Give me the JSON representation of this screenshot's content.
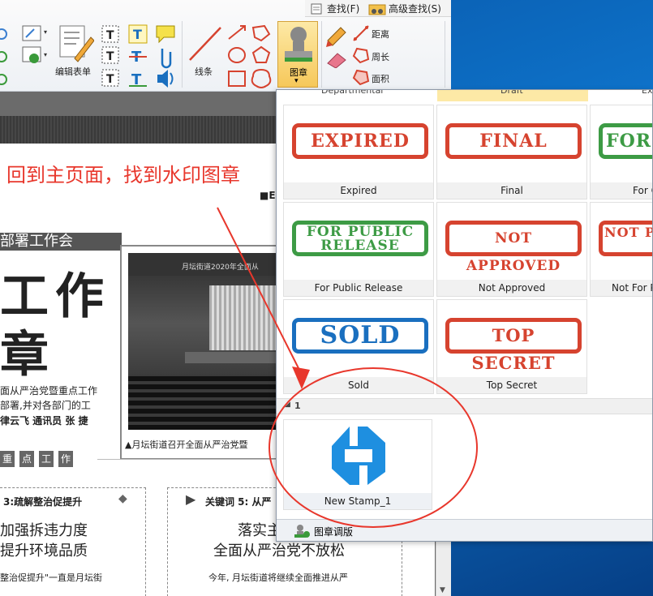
{
  "toolbar": {
    "search_label": "查找(F)",
    "advanced_search_label": "高级查找(S)",
    "edit_form_label": "编辑表单",
    "line_label": "线条",
    "stamp_label": "图章",
    "distance_label": "距离",
    "perimeter_label": "周长",
    "area_label": "面积"
  },
  "annotation": {
    "text": "回到主页面，找到水印图章"
  },
  "document": {
    "header_block": "■E",
    "section_title": "部署工作会",
    "big_char_1": "工作",
    "big_char_2": "章",
    "body_line_1": "面从严治党暨重点工作",
    "body_line_2": "部署,并对各部门的工",
    "byline": "律云飞 通讯员 张 捷",
    "banner_text": "月坛街道2020年全面从",
    "photo_caption": "▲月坛街道召开全面从严治党暨",
    "key_points": [
      "重",
      "点",
      "工",
      "作"
    ],
    "card1_title": "3:疏解整治促提升",
    "card1_line1": "加强拆违力度",
    "card1_line2": "提升环境品质",
    "card1_text": "整治促提升\"一直是月坛街",
    "card2_title": "关键词 5: 从严",
    "card2_line1": "落实主",
    "card2_line2": "全面从严治党不放松",
    "card2_text": "今年, 月坛街道将继续全面推进从严"
  },
  "panel": {
    "top_row_labels": [
      "Departmental",
      "Draft",
      "Expe"
    ],
    "stamps": [
      {
        "text": "EXPIRED",
        "caption": "Expired",
        "color": "red"
      },
      {
        "text": "FINAL",
        "caption": "Final",
        "color": "red"
      },
      {
        "text": "FOR CO",
        "caption": "For C",
        "color": "green"
      },
      {
        "text": "FOR PUBLIC RELEASE",
        "caption": "For Public Release",
        "color": "green"
      },
      {
        "text": "NOT APPROVED",
        "caption": "Not Approved",
        "color": "red"
      },
      {
        "text": "NOT PUBLIC",
        "caption": "Not For P",
        "color": "red"
      },
      {
        "text": "SOLD",
        "caption": "Sold",
        "color": "blue"
      },
      {
        "text": "TOP SECRET",
        "caption": "Top Secret",
        "color": "red"
      }
    ],
    "group_number": "1",
    "custom_stamp_caption": "New Stamp_1",
    "footer_label": "图章调版"
  },
  "colors": {
    "red": "#d6432f",
    "green": "#3d9b45",
    "blue": "#1a6fbf",
    "accent": "#e8372c",
    "logo": "#1e8fe0"
  }
}
